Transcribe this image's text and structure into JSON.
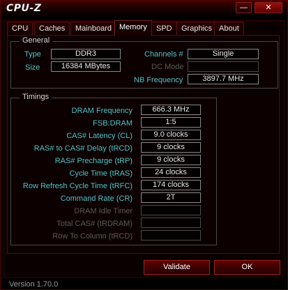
{
  "window": {
    "title": "CPU-Z",
    "minimize_glyph": "—",
    "close_glyph": "✕"
  },
  "tabs": [
    {
      "label": "CPU"
    },
    {
      "label": "Caches"
    },
    {
      "label": "Mainboard"
    },
    {
      "label": "Memory",
      "active": true
    },
    {
      "label": "SPD"
    },
    {
      "label": "Graphics"
    },
    {
      "label": "About"
    }
  ],
  "general": {
    "title": "General",
    "type_label": "Type",
    "type_value": "DDR3",
    "size_label": "Size",
    "size_value": "16384 MBytes",
    "channels_label": "Channels #",
    "channels_value": "Single",
    "dc_mode_label": "DC Mode",
    "dc_mode_value": "",
    "nb_freq_label": "NB Frequency",
    "nb_freq_value": "3897.7 MHz"
  },
  "timings": {
    "title": "Timings",
    "rows": [
      {
        "label": "DRAM Frequency",
        "value": "666.3 MHz",
        "enabled": true
      },
      {
        "label": "FSB:DRAM",
        "value": "1:5",
        "enabled": true
      },
      {
        "label": "CAS# Latency (CL)",
        "value": "9.0 clocks",
        "enabled": true
      },
      {
        "label": "RAS# to CAS# Delay (tRCD)",
        "value": "9 clocks",
        "enabled": true
      },
      {
        "label": "RAS# Precharge (tRP)",
        "value": "9 clocks",
        "enabled": true
      },
      {
        "label": "Cycle Time (tRAS)",
        "value": "24 clocks",
        "enabled": true
      },
      {
        "label": "Row Refresh Cycle Time (tRFC)",
        "value": "174 clocks",
        "enabled": true
      },
      {
        "label": "Command Rate (CR)",
        "value": "2T",
        "enabled": true
      },
      {
        "label": "DRAM Idle Timer",
        "value": "",
        "enabled": false
      },
      {
        "label": "Total CAS# (tRDRAM)",
        "value": "",
        "enabled": false
      },
      {
        "label": "Row To Column (tRCD)",
        "value": "",
        "enabled": false
      }
    ]
  },
  "buttons": {
    "validate": "Validate",
    "ok": "OK"
  },
  "footer": {
    "version": "Version 1.70.0"
  },
  "colors": {
    "accent_red": "#a12020",
    "label_teal": "#4fc4c8",
    "background": "#000000"
  }
}
